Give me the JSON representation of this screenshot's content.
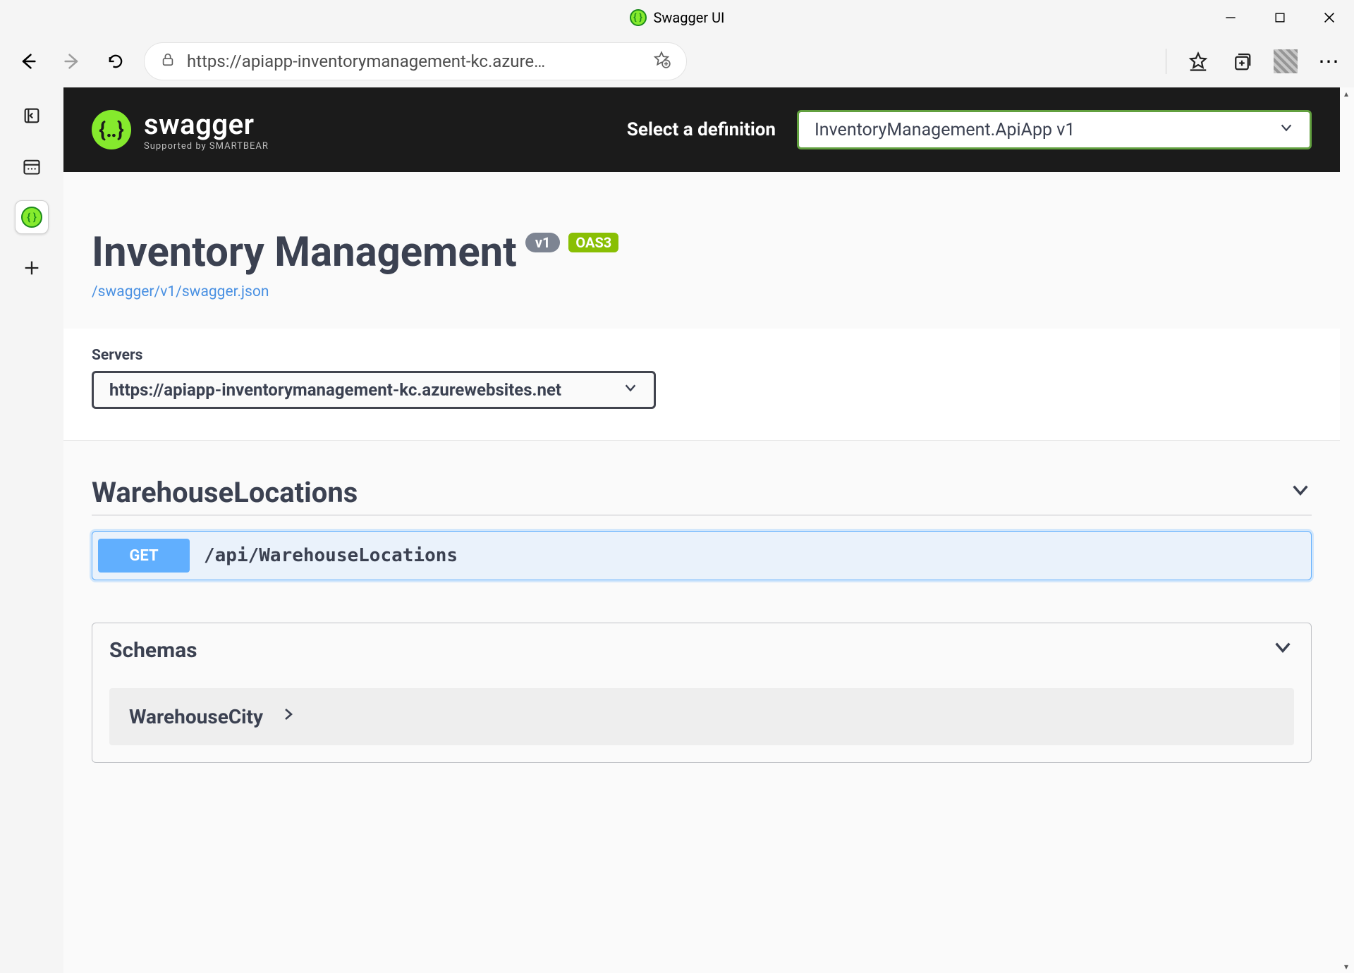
{
  "window": {
    "title": "Swagger UI"
  },
  "address_bar": {
    "url": "https://apiapp-inventorymanagement-kc.azure…"
  },
  "swagger_brand": {
    "name": "swagger",
    "supported_by": "Supported by SMARTBEAR"
  },
  "definition": {
    "label": "Select a definition",
    "selected": "InventoryManagement.ApiApp v1"
  },
  "info": {
    "title": "Inventory Management",
    "version_badge": "v1",
    "oas_badge": "OAS3",
    "json_link": "/swagger/v1/swagger.json"
  },
  "servers": {
    "label": "Servers",
    "selected": "https://apiapp-inventorymanagement-kc.azurewebsites.net"
  },
  "tags": [
    {
      "name": "WarehouseLocations",
      "operations": [
        {
          "method": "GET",
          "path": "/api/WarehouseLocations",
          "method_color": "#61affe"
        }
      ]
    }
  ],
  "schemas": {
    "header": "Schemas",
    "items": [
      "WarehouseCity"
    ]
  }
}
